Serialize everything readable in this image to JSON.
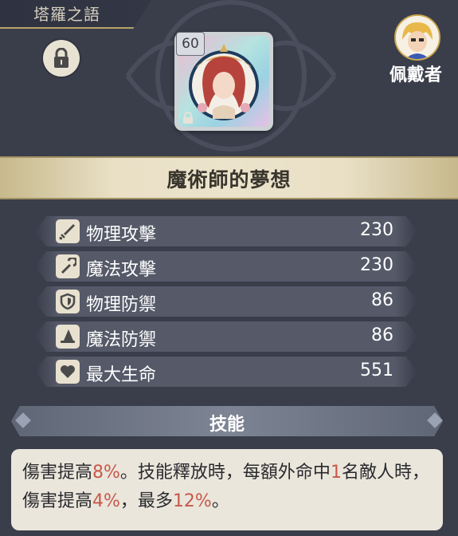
{
  "header": {
    "title": "塔羅之語"
  },
  "card": {
    "level": "60",
    "name": "魔術師的夢想"
  },
  "wearer": {
    "label": "佩戴者"
  },
  "stats": [
    {
      "icon": "sword-icon",
      "label": "物理攻擊",
      "value": "230"
    },
    {
      "icon": "staff-icon",
      "label": "魔法攻擊",
      "value": "230"
    },
    {
      "icon": "shield-icon",
      "label": "物理防禦",
      "value": "86"
    },
    {
      "icon": "wizard-hat-icon",
      "label": "魔法防禦",
      "value": "86"
    },
    {
      "icon": "heart-icon",
      "label": "最大生命",
      "value": "551"
    }
  ],
  "skill": {
    "header": "技能",
    "desc": {
      "p1": "傷害提高",
      "v1": "8%",
      "p2": "。技能釋放時，每額外命中",
      "v2": "1",
      "p3": "名敵人時，傷害提高",
      "v3": "4%",
      "p4": "，最多",
      "v4": "12%",
      "p5": "。"
    }
  },
  "colors": {
    "highlight": "#c8584a",
    "banner": "#e9e0c6",
    "background": "#3a3e4b"
  }
}
